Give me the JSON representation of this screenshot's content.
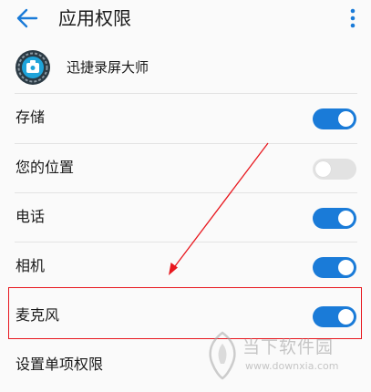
{
  "header": {
    "title": "应用权限",
    "back_icon": "arrow-left-icon",
    "more_icon": "more-vertical-icon"
  },
  "app": {
    "name": "迅捷录屏大师",
    "icon": "camera-app-icon"
  },
  "permissions": [
    {
      "label": "存储",
      "enabled": true
    },
    {
      "label": "您的位置",
      "enabled": false
    },
    {
      "label": "电话",
      "enabled": true
    },
    {
      "label": "相机",
      "enabled": true
    },
    {
      "label": "麦克风",
      "enabled": true
    }
  ],
  "single_permission": {
    "label": "设置单项权限"
  },
  "watermark": {
    "title": "当下软件园",
    "url": "www.downxia.com"
  },
  "colors": {
    "accent": "#1a7bd8",
    "toggle_off": "#e2e2e2",
    "annotation_red": "#e8171e"
  }
}
